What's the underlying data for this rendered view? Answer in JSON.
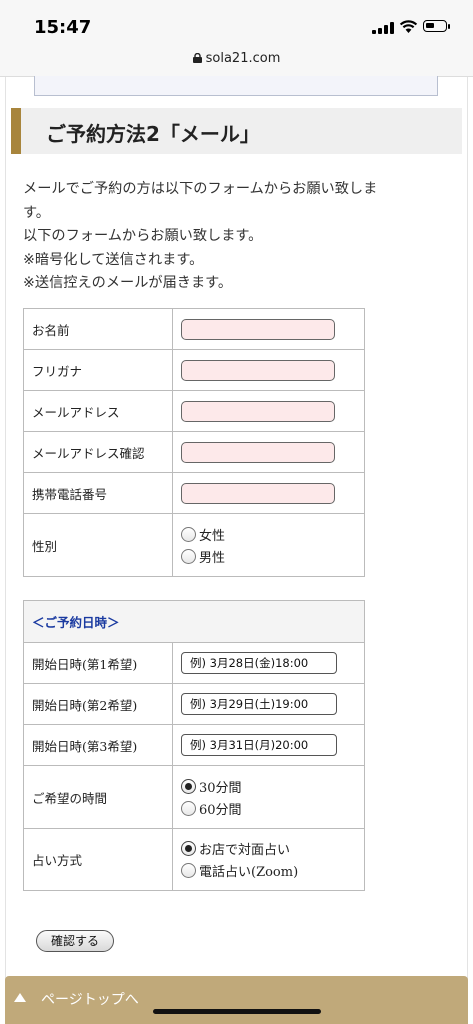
{
  "status_bar": {
    "time": "15:47"
  },
  "url_bar": {
    "domain": "sola21.com"
  },
  "heading": "ご予約方法2「メール」",
  "intro_lines": [
    "メールでご予約の方は以下のフォームからお願い致しま",
    "す。",
    "以下のフォームからお願い致します。",
    "※暗号化して送信されます。",
    "※送信控えのメールが届きます。"
  ],
  "personal": {
    "name_label": "お名前",
    "furigana_label": "フリガナ",
    "email_label": "メールアドレス",
    "email_confirm_label": "メールアドレス確認",
    "phone_label": "携帯電話番号",
    "gender_label": "性別",
    "gender_options": [
      "女性",
      "男性"
    ],
    "gender_selected": null
  },
  "reservation": {
    "section_title": "＜ご予約日時＞",
    "first_label": "開始日時(第1希望)",
    "first_placeholder": "例) 3月28日(金)18:00",
    "second_label": "開始日時(第2希望)",
    "second_placeholder": "例) 3月29日(土)19:00",
    "third_label": "開始日時(第3希望)",
    "third_placeholder": "例) 3月31日(月)20:00",
    "duration_label": "ご希望の時間",
    "duration_options": [
      "30分間",
      "60分間"
    ],
    "duration_selected": "30分間",
    "method_label": "占い方式",
    "method_options": [
      "お店で対面占い",
      "電話占い(Zoom)"
    ],
    "method_selected": "お店で対面占い"
  },
  "confirm_button": "確認する",
  "page_top": "ページトップへ",
  "colors": {
    "heading_accent": "#a8853c",
    "input_bg": "#fde9ea",
    "section_title": "#1a3aa0",
    "page_top_bar": "#c0a97a"
  }
}
